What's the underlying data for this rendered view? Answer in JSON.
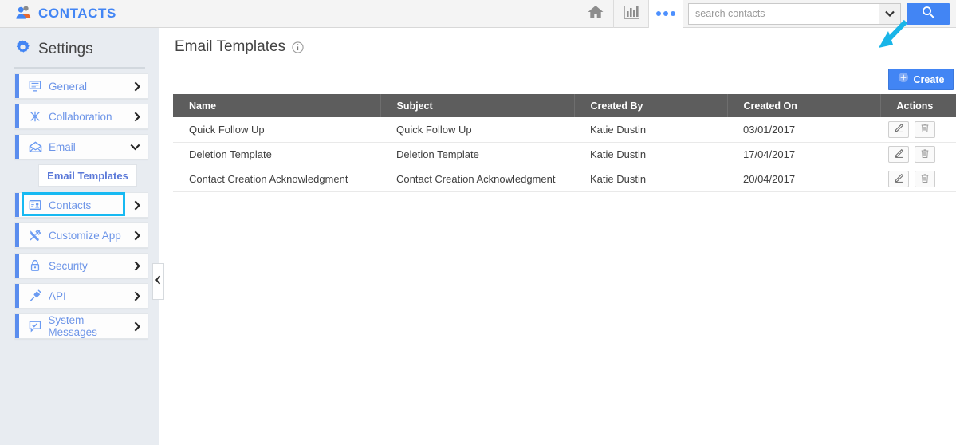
{
  "header": {
    "brand_icon": "contacts-people-icon",
    "brand_title": "CONTACTS",
    "home_icon": "home-icon",
    "reports_icon": "bar-chart-icon",
    "more_icon": "more-dots-icon",
    "search": {
      "placeholder": "search contacts",
      "value": "",
      "caret_icon": "chevron-down-icon",
      "go_icon": "search-icon"
    },
    "accent_color": "#4285f4"
  },
  "sidebar": {
    "gear_icon": "gear-icon",
    "title": "Settings",
    "collapse_icon": "chevron-left-icon",
    "items": [
      {
        "label": "General",
        "icon": "monitor-icon",
        "chevron": "chevron-right-icon",
        "expanded": false
      },
      {
        "label": "Collaboration",
        "icon": "share-nodes-icon",
        "chevron": "chevron-right-icon",
        "expanded": false
      },
      {
        "label": "Email",
        "icon": "envelope-open-icon",
        "chevron": "chevron-down-icon",
        "expanded": true
      },
      {
        "label": "Contacts",
        "icon": "contact-card-icon",
        "chevron": "chevron-right-icon",
        "expanded": false
      },
      {
        "label": "Customize App",
        "icon": "tools-icon",
        "chevron": "chevron-right-icon",
        "expanded": false
      },
      {
        "label": "Security",
        "icon": "lock-icon",
        "chevron": "chevron-right-icon",
        "expanded": false
      },
      {
        "label": "API",
        "icon": "plug-icon",
        "chevron": "chevron-right-icon",
        "expanded": false
      },
      {
        "label": "System Messages",
        "icon": "message-check-icon",
        "chevron": "chevron-right-icon",
        "expanded": false
      }
    ],
    "sub_item": {
      "label": "Email Templates",
      "selected": true
    },
    "accent_bar_color": "#5a8dee",
    "link_color": "#6d95e8"
  },
  "main": {
    "page_title": "Email Templates",
    "info_icon": "info-circle-icon",
    "create_button": {
      "label": "Create",
      "icon": "plus-circle-icon"
    },
    "table": {
      "columns": [
        "Name",
        "Subject",
        "Created By",
        "Created On",
        "Actions"
      ],
      "rows": [
        {
          "name": "Quick Follow Up",
          "subject": "Quick Follow Up",
          "created_by": "Katie Dustin",
          "created_on": "03/01/2017",
          "actions": [
            "edit-pencil-icon",
            "trash-icon"
          ]
        },
        {
          "name": "Deletion Template",
          "subject": "Deletion Template",
          "created_by": "Katie Dustin",
          "created_on": "17/04/2017",
          "actions": [
            "edit-pencil-icon",
            "trash-icon"
          ]
        },
        {
          "name": "Contact Creation Acknowledgment",
          "subject": "Contact Creation Acknowledgment",
          "created_by": "Katie Dustin",
          "created_on": "20/04/2017",
          "actions": [
            "edit-pencil-icon",
            "trash-icon"
          ]
        }
      ],
      "header_bg": "#5d5d5d"
    }
  },
  "annotations": {
    "arrow": {
      "icon": "pointer-arrow-icon",
      "color": "#19b5e8",
      "target": "Create"
    },
    "highlight_box": {
      "color": "#17b9f2",
      "target": "Email Templates"
    }
  }
}
